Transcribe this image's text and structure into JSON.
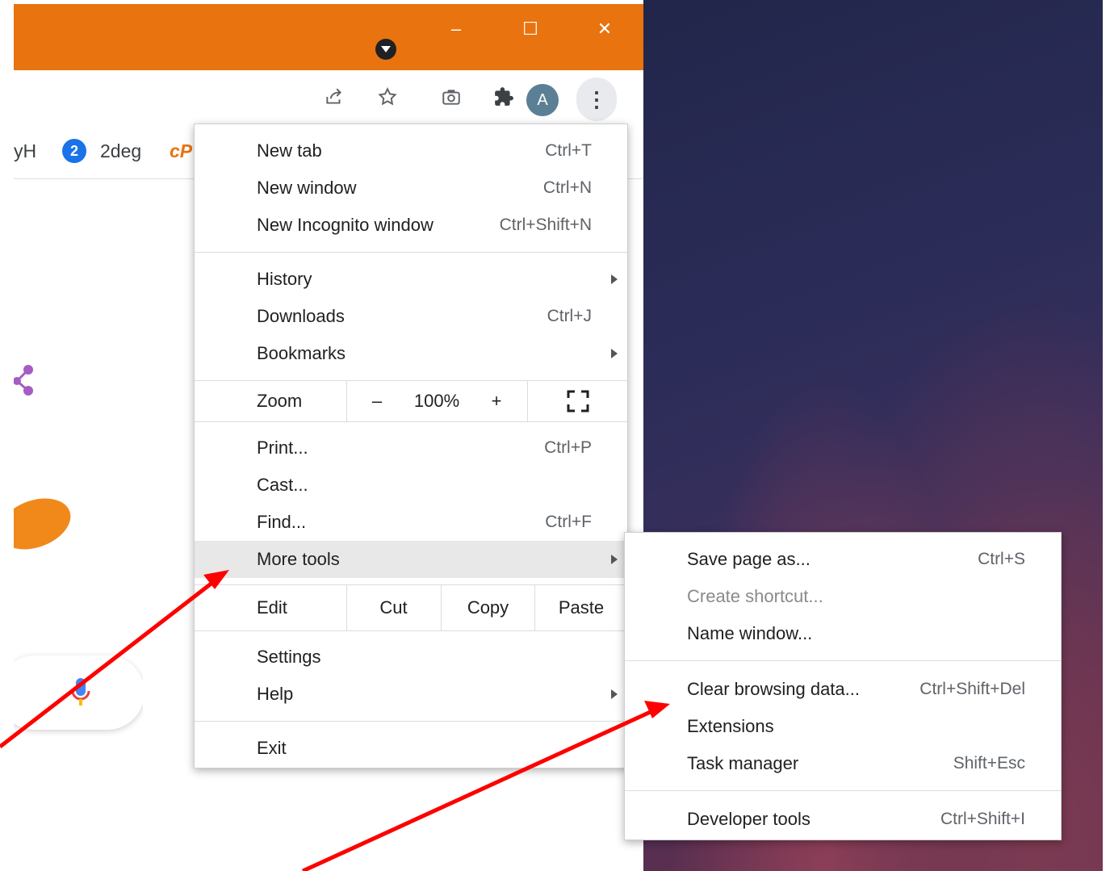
{
  "window": {
    "minimize": "–",
    "maximize": "☐",
    "close": "✕"
  },
  "toolbar": {
    "avatar_letter": "A",
    "kebab": "⋮"
  },
  "bookmarks": {
    "items": [
      {
        "label": "yH"
      },
      {
        "label": "2deg",
        "badge": "2"
      },
      {
        "label": "cP"
      }
    ]
  },
  "main_menu": {
    "new_tab": {
      "label": "New tab",
      "shortcut": "Ctrl+T"
    },
    "new_window": {
      "label": "New window",
      "shortcut": "Ctrl+N"
    },
    "new_incognito": {
      "label": "New Incognito window",
      "shortcut": "Ctrl+Shift+N"
    },
    "history": {
      "label": "History"
    },
    "downloads": {
      "label": "Downloads",
      "shortcut": "Ctrl+J"
    },
    "bookmarks": {
      "label": "Bookmarks"
    },
    "zoom": {
      "label": "Zoom",
      "minus": "–",
      "value": "100%",
      "plus": "+"
    },
    "print": {
      "label": "Print...",
      "shortcut": "Ctrl+P"
    },
    "cast": {
      "label": "Cast..."
    },
    "find": {
      "label": "Find...",
      "shortcut": "Ctrl+F"
    },
    "more_tools": {
      "label": "More tools"
    },
    "edit": {
      "label": "Edit",
      "cut": "Cut",
      "copy": "Copy",
      "paste": "Paste"
    },
    "settings": {
      "label": "Settings"
    },
    "help": {
      "label": "Help"
    },
    "exit": {
      "label": "Exit"
    }
  },
  "sub_menu": {
    "save_page": {
      "label": "Save page as...",
      "shortcut": "Ctrl+S"
    },
    "create_shortcut": {
      "label": "Create shortcut..."
    },
    "name_window": {
      "label": "Name window..."
    },
    "clear_browsing": {
      "label": "Clear browsing data...",
      "shortcut": "Ctrl+Shift+Del"
    },
    "extensions": {
      "label": "Extensions"
    },
    "task_manager": {
      "label": "Task manager",
      "shortcut": "Shift+Esc"
    },
    "developer_tools": {
      "label": "Developer tools",
      "shortcut": "Ctrl+Shift+I"
    }
  },
  "colors": {
    "titlebar": "#e8730f",
    "annotation_arrow": "#ff0000",
    "menu_highlight": "#e8e8e8"
  }
}
